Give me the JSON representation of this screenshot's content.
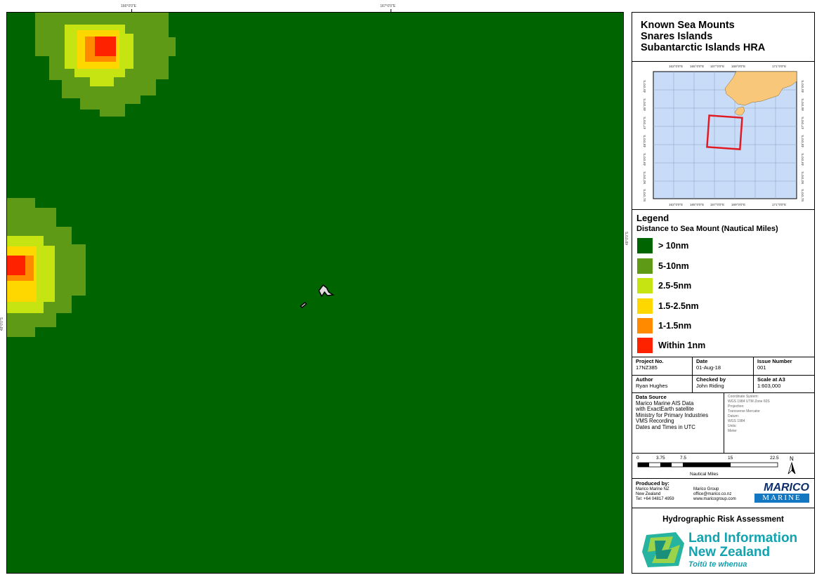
{
  "map": {
    "top_ticks": [
      "166°0'0\"E",
      "167°0'0\"E"
    ],
    "right_ticks": [
      "48°0'0\"S"
    ],
    "left_ticks": [
      "48°0'0\"S"
    ]
  },
  "title": {
    "line1": "Known Sea Mounts",
    "line2": "Snares Islands",
    "line3": "Subantarctic Islands HRA"
  },
  "inset": {
    "top_ticks": [
      "163°0'0\"E",
      "165°0'0\"E",
      "167°0'0\"E",
      "169°0'0\"E",
      "171°0'0\"E"
    ],
    "bottom_ticks": [
      "163°0'0\"E",
      "165°0'0\"E",
      "167°0'0\"E",
      "169°0'0\"E",
      "171°0'0\"E"
    ],
    "lat_ticks": [
      "45°0'0\"S",
      "46°0'0\"S",
      "47°0'0\"S",
      "48°0'0\"S",
      "49°0'0\"S",
      "50°0'0\"S",
      "51°0'0\"S"
    ]
  },
  "legend": {
    "title": "Legend",
    "subtitle": "Distance to Sea Mount (Nautical Miles)",
    "items": [
      {
        "label": "> 10nm",
        "color": "#006400"
      },
      {
        "label": "5-10nm",
        "color": "#5e9a16"
      },
      {
        "label": "2.5-5nm",
        "color": "#c5e412"
      },
      {
        "label": "1.5-2.5nm",
        "color": "#ffd700"
      },
      {
        "label": "1-1.5nm",
        "color": "#ff8a00"
      },
      {
        "label": "Within 1nm",
        "color": "#ff2200"
      }
    ]
  },
  "info": {
    "project_no_label": "Project No.",
    "project_no": "17NZ385",
    "date_label": "Date",
    "date": "01-Aug-18",
    "issue_label": "Issue Number",
    "issue": "001",
    "author_label": "Author",
    "author": "Ryan Hughes",
    "checked_label": "Checked by",
    "checked": "John Riding",
    "scale_label": "Scale at A3",
    "scale": "1:603,000",
    "data_source_label": "Data Source",
    "data_source": [
      "Marico Marine AIS Data",
      "with ExactEarth satellite",
      "Ministry for Primary Industries",
      "VMS Recording",
      "Dates and Times in UTC"
    ],
    "coords": [
      "Coordinate System:",
      "WGS 1984 UTM Zone 60S",
      "Projection:",
      "Transverse Mercator",
      "Datum:",
      "WGS 1984",
      "Units:",
      "Meter"
    ]
  },
  "scalebar": {
    "ticks": [
      "0",
      "3.75",
      "7.5",
      "15",
      "22.5"
    ],
    "unit": "Nautical Miles",
    "north": "N"
  },
  "produced": {
    "label": "Produced by:",
    "left": [
      "Marico Marine NZ",
      "New Zealand",
      "Tel: +64 04817 4959"
    ],
    "right": [
      "Marico Group",
      "office@marico.co.nz",
      "www.maricogroup.com"
    ],
    "logo_top": "MARICO",
    "logo_bottom": "MARINE"
  },
  "footer": {
    "hra_title": "Hydrographic Risk Assessment",
    "linz_line1": "Land Information",
    "linz_line2": "New Zealand",
    "linz_line3": "Toitū te whenua"
  },
  "colors": {
    "deep_green": "#006400",
    "inset_sea": "#c8dcf8",
    "inset_land": "#f9c77a",
    "aoi_red": "#e01b24",
    "linz_teal": "#11a3b0",
    "marico_blue": "#1477c1"
  }
}
